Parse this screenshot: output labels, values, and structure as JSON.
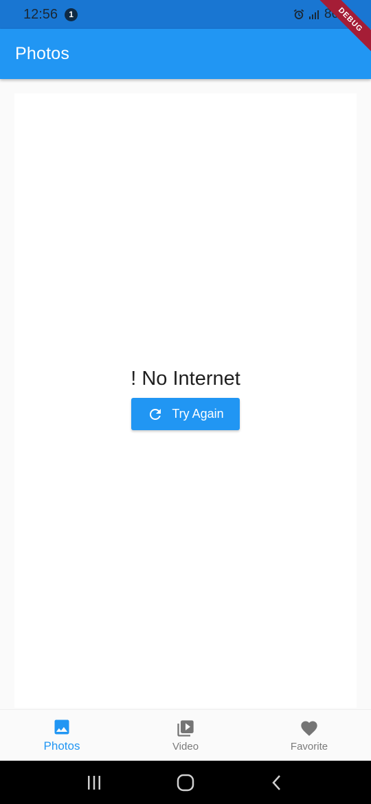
{
  "status_bar": {
    "time": "12:56",
    "notification_count": "1",
    "battery": "86%"
  },
  "debug_banner": "DEBUG",
  "app_bar": {
    "title": "Photos"
  },
  "empty_state": {
    "message": "! No Internet",
    "button_label": "Try Again",
    "button_icon": "refresh-icon"
  },
  "bottom_nav": {
    "items": [
      {
        "label": "Photos",
        "icon": "image-icon",
        "active": true
      },
      {
        "label": "Video",
        "icon": "video-library-icon",
        "active": false
      },
      {
        "label": "Favorite",
        "icon": "heart-icon",
        "active": false
      }
    ]
  },
  "colors": {
    "primary": "#2196f3",
    "status_bar": "#1976d2",
    "inactive": "#7a7a7a",
    "debug": "#a51d36"
  }
}
